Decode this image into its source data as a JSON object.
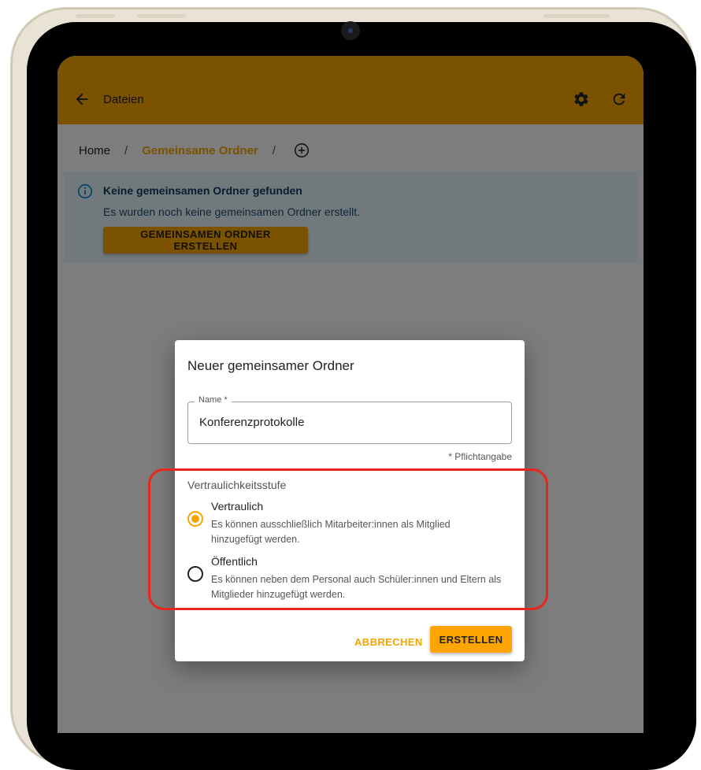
{
  "app": {
    "title": "Dateien",
    "colors": {
      "primary": "#f5a400",
      "info_bg": "#e4f2fb",
      "highlight": "#e8261b"
    },
    "icons": {
      "back": "arrow-back-icon",
      "settings": "gear-icon",
      "refresh": "refresh-icon",
      "add": "add-circle-icon",
      "info": "info-icon"
    }
  },
  "breadcrumb": {
    "items": [
      "Home",
      "Gemeinsame Ordner"
    ],
    "separator": "/"
  },
  "alert": {
    "title": "Keine gemeinsamen Ordner gefunden",
    "text": "Es wurden noch keine gemeinsamen Ordner erstellt.",
    "button_label": "GEMEINSAMEN ORDNER ERSTELLEN"
  },
  "dialog": {
    "title": "Neuer gemeinsamer Ordner",
    "name_field": {
      "label": "Name *",
      "value": "Konferenzprotokolle"
    },
    "required_note": "* Pflichtangabe",
    "confidentiality": {
      "label": "Vertraulichkeitsstufe",
      "options": [
        {
          "label": "Vertraulich",
          "description": "Es können ausschließlich Mitarbeiter:innen als Mitglied hinzugefügt werden.",
          "selected": true
        },
        {
          "label": "Öffentlich",
          "description": "Es können neben dem Personal auch Schüler:innen und Eltern als Mitglieder hinzugefügt werden.",
          "selected": false
        }
      ]
    },
    "cancel_label": "ABBRECHEN",
    "create_label": "ERSTELLEN"
  }
}
